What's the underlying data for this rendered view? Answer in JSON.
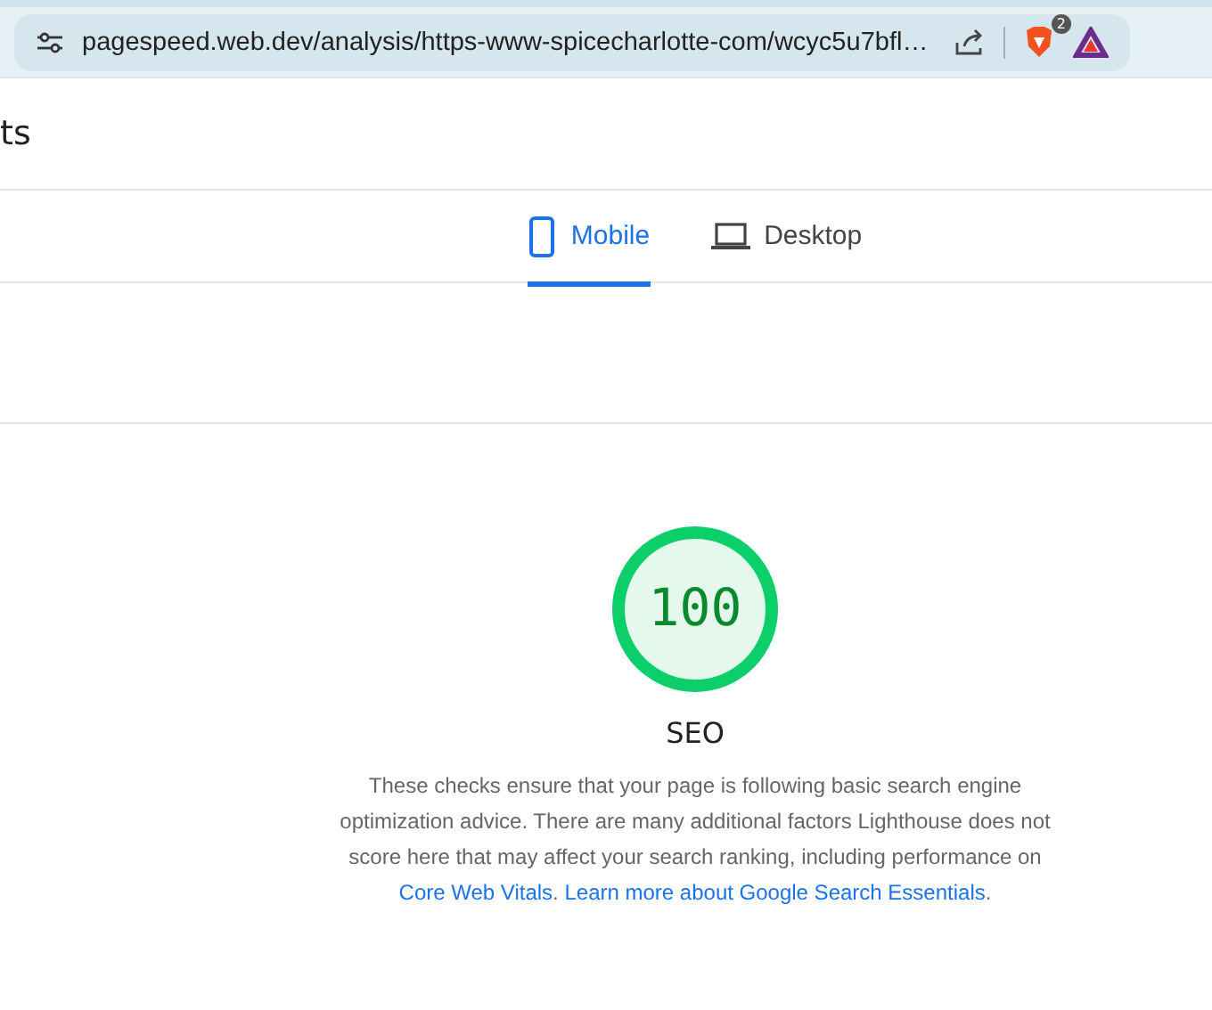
{
  "browser": {
    "url": "pagespeed.web.dev/analysis/https-www-spicecharlotte-com/wcyc5u7bfl…",
    "shield_badge": "2"
  },
  "page": {
    "heading": "ts"
  },
  "tabs": [
    {
      "label": "Mobile",
      "kind": "phone",
      "selected": true
    },
    {
      "label": "Desktop",
      "kind": "laptop",
      "selected": false
    }
  ],
  "score": {
    "value": "100",
    "level": 1,
    "title": "SEO",
    "description": "These checks ensure that your page is following basic search engine optimization advice. There are many additional factors Lighthouse does not score here that may affect your search ranking, including performance on ",
    "links": [
      {
        "text": "Core Web Vitals",
        "after": ". "
      },
      {
        "text": "Learn more about Google Search Essentials",
        "after": "."
      }
    ]
  }
}
